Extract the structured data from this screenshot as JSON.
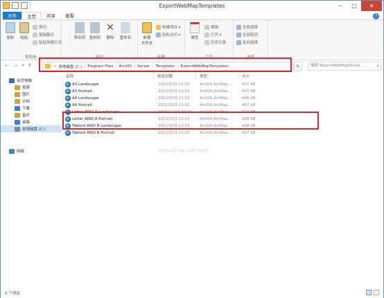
{
  "window": {
    "title": "ExportWebMapTemplates",
    "minimize": "─",
    "maximize": "□",
    "close": "✕"
  },
  "ribbon_tabs": [
    "文件",
    "主页",
    "共享",
    "查看"
  ],
  "help": "?",
  "ribbon": {
    "clipboard": {
      "label": "剪贴板",
      "copy": "复制",
      "paste": "粘贴",
      "cut": "剪切",
      "copy_path": "复制路径",
      "paste_shortcut": "粘贴快捷方式"
    },
    "organize": {
      "label": "组织",
      "move_to": "移动到",
      "copy_to": "复制到",
      "delete": "删除",
      "rename": "重命名"
    },
    "new": {
      "label": "新建",
      "new_folder": "新建\n文件夹",
      "new_item": "新建项目 ▾",
      "easy_access": "轻松访问 ▾"
    },
    "open": {
      "label": "打开",
      "properties": "属性",
      "open_btn": "打开 ▾",
      "edit": "编辑",
      "history": "历史记录"
    },
    "select": {
      "label": "选择",
      "select_all": "全部选择",
      "select_none": "全部取消",
      "invert": "反向选择"
    }
  },
  "address": {
    "crumbs": [
      "本地磁盘 (C:)",
      "Program Files",
      "ArcGIS",
      "Server",
      "Templates",
      "ExportWebMapTemplates"
    ],
    "search_placeholder": "搜索\"ExportWebMapTempl...",
    "refresh": "↻",
    "back": "←",
    "forward": "→",
    "up": "↑",
    "history": "▾"
  },
  "nav_pane": {
    "items": [
      {
        "label": "台式电脑",
        "color": "#3b6fb0"
      },
      {
        "label": "视频",
        "color": "#c9a24a"
      },
      {
        "label": "图片",
        "color": "#c9a24a"
      },
      {
        "label": "文档",
        "color": "#c9a24a"
      },
      {
        "label": "下载",
        "color": "#3a83c9"
      },
      {
        "label": "音乐",
        "color": "#c9a24a"
      },
      {
        "label": "桌面",
        "color": "#3a83c9"
      },
      {
        "label": "本地磁盘 (C:)",
        "color": "#7f8c99"
      },
      {
        "label": "网络",
        "color": "#3a83c9"
      }
    ]
  },
  "file_list": {
    "headers": {
      "name": "名称",
      "date": "修改日期",
      "type": "类型",
      "size": "大小"
    },
    "rows": [
      {
        "name": "A3 Landscape",
        "date": "2012/3/15 11:02",
        "type": "ArcGIS ArcMap ...",
        "size": "407 KB"
      },
      {
        "name": "A3 Portrait",
        "date": "2012/3/15 11:02",
        "type": "ArcGIS ArcMap ...",
        "size": "407 KB"
      },
      {
        "name": "A4 Landscape",
        "date": "2012/3/15 11:02",
        "type": "ArcGIS ArcMap ...",
        "size": "406 KB"
      },
      {
        "name": "A4 Portrait",
        "date": "2012/3/15 11:02",
        "type": "ArcGIS ArcMap ...",
        "size": "407 KB"
      },
      {
        "name": "Letter ANSI A Landscape",
        "date": "2015/11/15 15:30",
        "type": "ArcGIS ArcMap ...",
        "size": "943 KB"
      },
      {
        "name": "Letter ANSI A Portrait",
        "date": "2012/3/15 11:03",
        "type": "ArcGIS ArcMap ...",
        "size": "408 KB"
      },
      {
        "name": "Tabloid ANSI B Landscape",
        "date": "2012/3/15 11:03",
        "type": "ArcGIS ArcMap ...",
        "size": "408 KB"
      },
      {
        "name": "Tabloid ANSI B Portrait",
        "date": "2012/3/15 11:03",
        "type": "ArcGIS ArcMap ...",
        "size": "407 KB"
      }
    ]
  },
  "watermark": "http://blog.csdn.net/",
  "status": {
    "count": "8 个项目"
  },
  "colors": {
    "file_tab": "#1979ca",
    "highlight_box": "#d9262b",
    "selected_nav": "#cde4f7"
  }
}
